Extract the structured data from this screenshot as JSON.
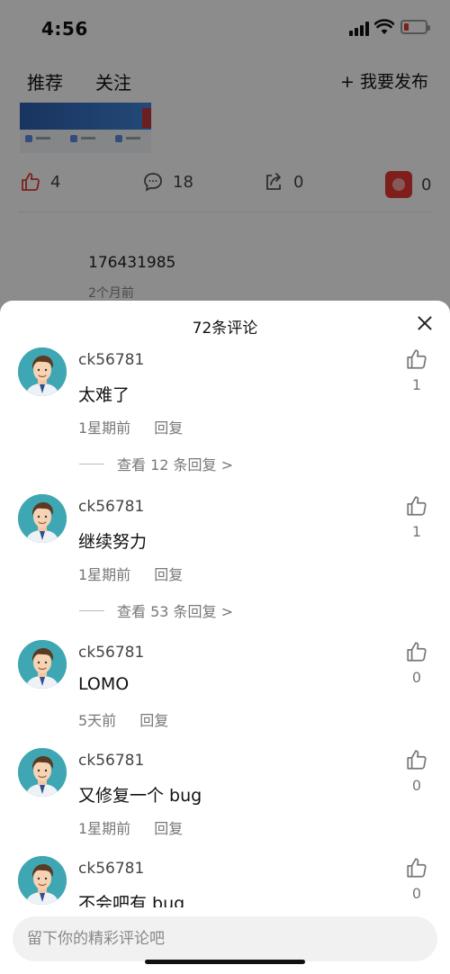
{
  "status_bar": {
    "time": "4:56",
    "battery_level": 0.22,
    "battery_color": "#e03b2f"
  },
  "feed": {
    "tabs": [
      {
        "label": "推荐"
      },
      {
        "label": "关注"
      }
    ],
    "publish_label": "+ 我要发布",
    "stats": {
      "likes": "4",
      "comments": "18",
      "shares": "0",
      "gift": "0"
    },
    "post_user": "176431985",
    "post_time": "2个月前"
  },
  "comments_panel": {
    "title": "72条评论",
    "input_placeholder": "留下你的精彩评论吧",
    "comments": [
      {
        "user": "ck56781",
        "text": "太难了",
        "time": "1星期前",
        "reply_label": "回复",
        "likes": "1",
        "view_replies": "查看 12 条回复 >"
      },
      {
        "user": "ck56781",
        "text": "继续努力",
        "time": "1星期前",
        "reply_label": "回复",
        "likes": "1",
        "view_replies": "查看 53 条回复 >"
      },
      {
        "user": "ck56781",
        "text": "LOMO",
        "time": "5天前",
        "reply_label": "回复",
        "likes": "0"
      },
      {
        "user": "ck56781",
        "text": "又修复一个 bug",
        "time": "1星期前",
        "reply_label": "回复",
        "likes": "0"
      },
      {
        "user": "ck56781",
        "text": "不会吧有 bug",
        "likes": "0"
      }
    ]
  },
  "colors": {
    "accent_red": "#e53935",
    "avatar_bg": "#3fa7b4"
  }
}
